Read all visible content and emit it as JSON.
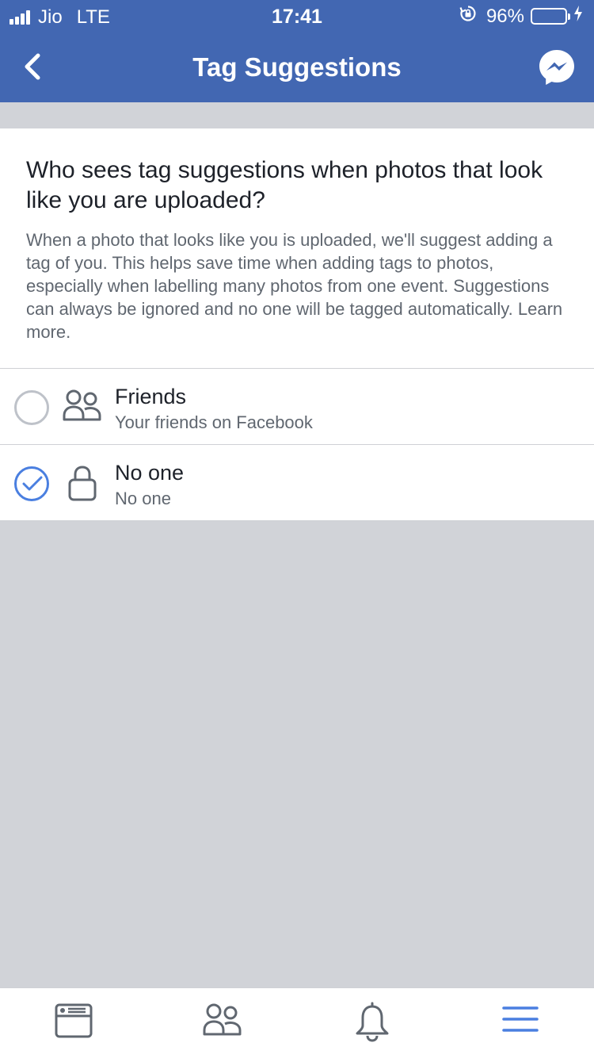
{
  "status_bar": {
    "carrier": "Jio",
    "network": "LTE",
    "time": "17:41",
    "battery": "96%",
    "battery_level": 0.96
  },
  "nav": {
    "title": "Tag Suggestions"
  },
  "info": {
    "question": "Who sees tag suggestions when photos that look like you are uploaded?",
    "description": "When a photo that looks like you is uploaded, we'll suggest adding a tag of you. This helps save time when adding tags to photos, especially when labelling many photos from one event. Suggestions can always be ignored and no one will be tagged automatically.",
    "learn_more": "Learn more."
  },
  "options": [
    {
      "title": "Friends",
      "subtitle": "Your friends on Facebook",
      "icon": "friends-icon",
      "selected": false
    },
    {
      "title": "No one",
      "subtitle": "No one",
      "icon": "lock-icon",
      "selected": true
    }
  ],
  "tabs": [
    {
      "icon": "news-feed-icon"
    },
    {
      "icon": "friends-icon"
    },
    {
      "icon": "notifications-bell-icon"
    },
    {
      "icon": "menu-icon",
      "active": true
    }
  ],
  "colors": {
    "brand": "#4267b2",
    "accent": "#4a7fe0",
    "background": "#d1d3d8",
    "battery_green": "#4cd964"
  }
}
